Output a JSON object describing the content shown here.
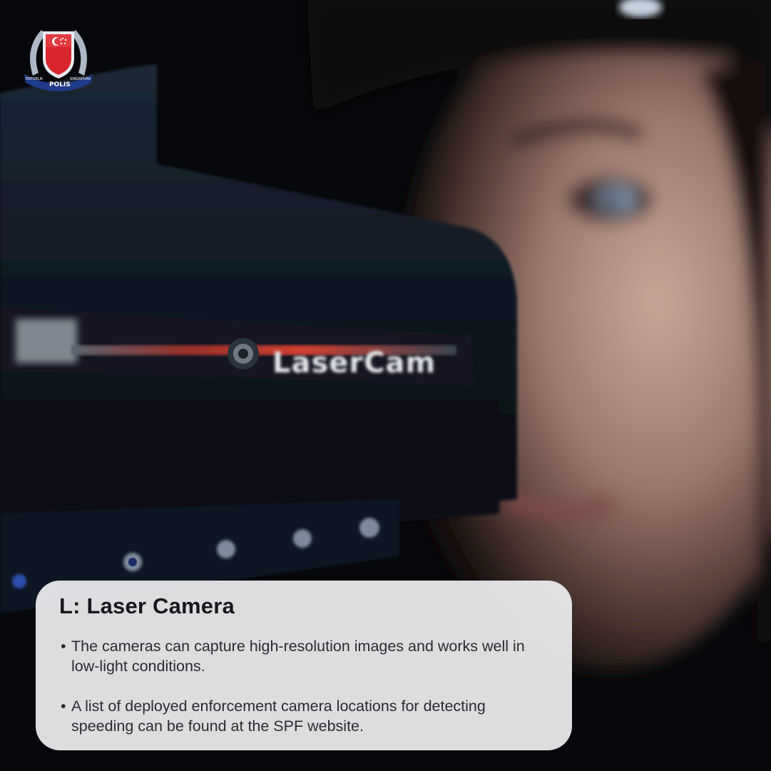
{
  "logo": {
    "text_top_left": "REPUBLIK",
    "text_center": "POLIS",
    "text_top_right": "SINGAPURA",
    "colors": {
      "shield": "#d9262e",
      "wreath": "#aeb7c6",
      "ribbon": "#1f3a8a"
    }
  },
  "photo": {
    "device_label": "LaserCam"
  },
  "card": {
    "title": "L: Laser Camera",
    "bullet_glyph": "•",
    "bullets": [
      "The cameras can capture high-resolution images and works well in low-light conditions.",
      "A list of deployed enforcement camera  locations for detecting speeding can be found at the SPF website."
    ]
  }
}
